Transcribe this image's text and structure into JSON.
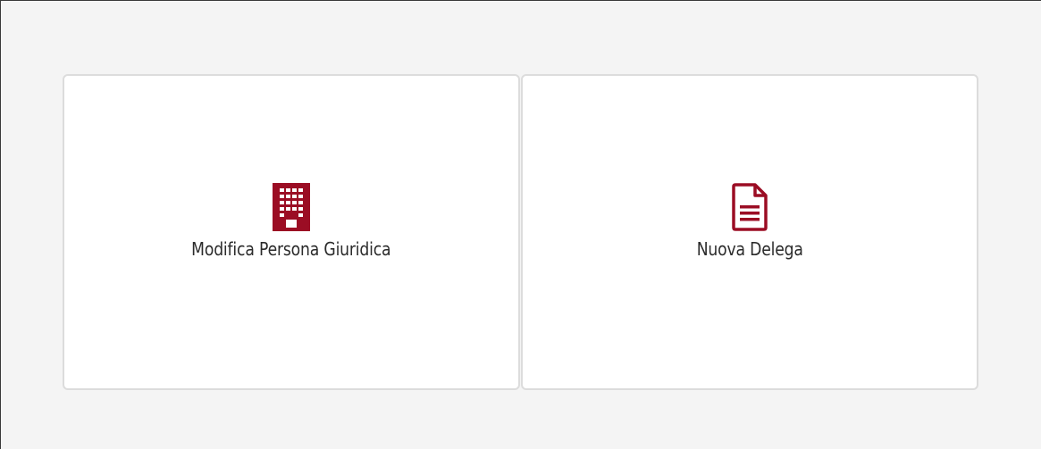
{
  "colors": {
    "accent": "#9b0d24",
    "page_background": "#f4f4f4",
    "card_background": "#ffffff",
    "card_border": "#dcdcdc",
    "text": "#2b2b2b"
  },
  "cards": [
    {
      "label": "Modifica Persona Giuridica",
      "icon": "building-icon"
    },
    {
      "label": "Nuova Delega",
      "icon": "document-icon"
    }
  ]
}
